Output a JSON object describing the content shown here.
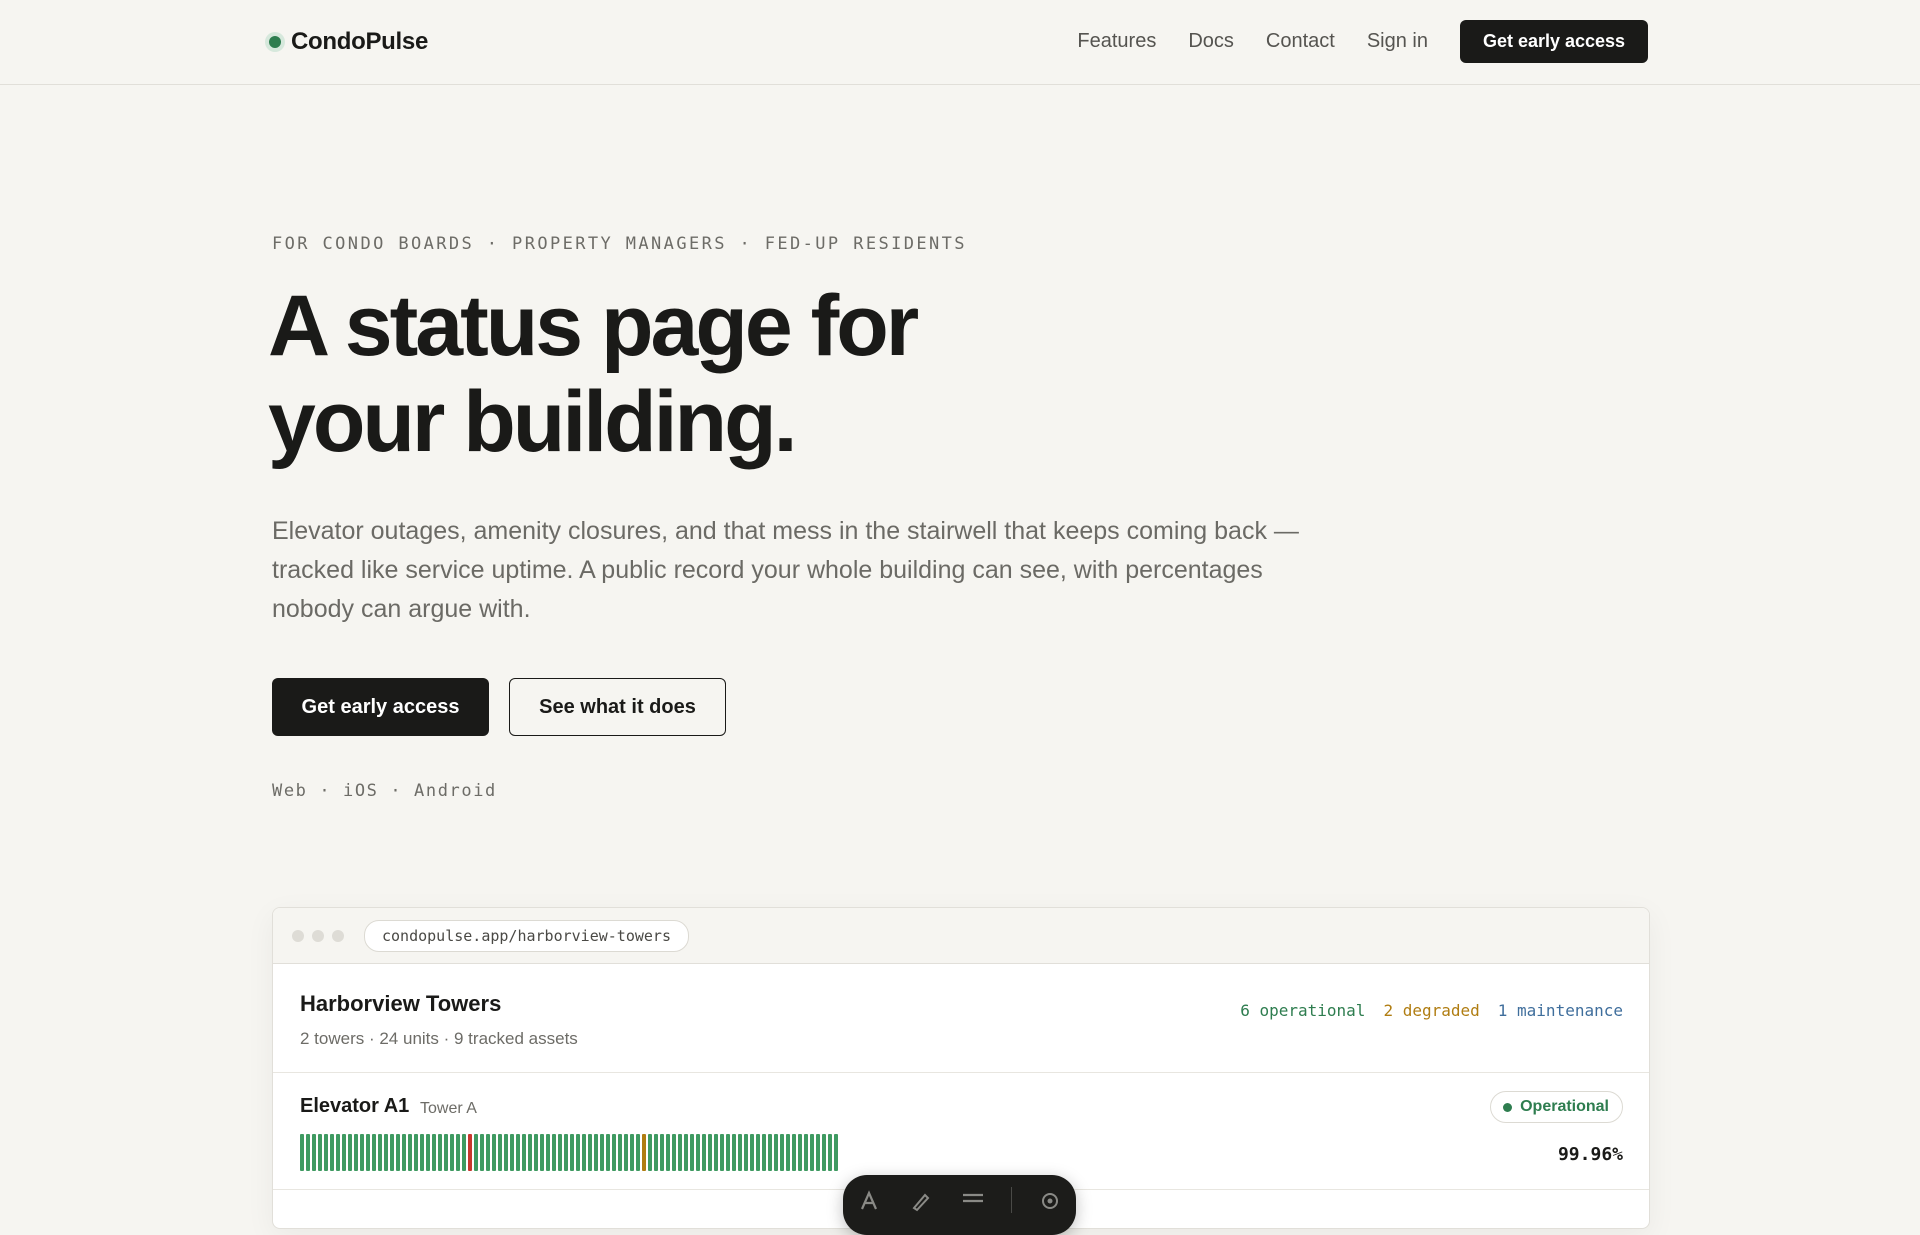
{
  "brand": {
    "name": "CondoPulse"
  },
  "nav": {
    "links": [
      "Features",
      "Docs",
      "Contact",
      "Sign in"
    ],
    "cta": "Get early access"
  },
  "hero": {
    "eyebrow": "FOR CONDO BOARDS · PROPERTY MANAGERS · FED-UP RESIDENTS",
    "headline_line1": "A status page for",
    "headline_line2": "your building.",
    "subhead": "Elevator outages, amenity closures, and that mess in the stairwell that keeps coming back — tracked like service uptime. A public record your whole building can see, with percentages nobody can argue with.",
    "primary_cta": "Get early access",
    "secondary_cta": "See what it does",
    "platforms": "Web · iOS · Android"
  },
  "preview": {
    "url": "condopulse.app/harborview-towers",
    "building_name": "Harborview Towers",
    "building_meta": "2 towers · 24 units · 9 tracked assets",
    "counts": {
      "operational": "6 operational",
      "degraded": "2 degraded",
      "maintenance": "1 maintenance"
    },
    "assets": [
      {
        "name": "Elevator A1",
        "location": "Tower A",
        "status": "Operational",
        "uptime": "99.96%",
        "history": {
          "days": 90,
          "incidents": [
            {
              "day": 28,
              "state": "outage"
            },
            {
              "day": 57,
              "state": "degraded"
            }
          ]
        }
      }
    ]
  },
  "colors": {
    "accent": "#1a1a18",
    "operational": "#2e7d4f",
    "degraded": "#b07d12",
    "maintenance": "#3f6e9c",
    "outage": "#c8372d",
    "uptime_bar": "#3f9a61",
    "background": "#f6f5f1"
  },
  "toolbar": {
    "icons": [
      "text-icon",
      "pen-icon",
      "menu-icon",
      "settings-icon"
    ]
  }
}
